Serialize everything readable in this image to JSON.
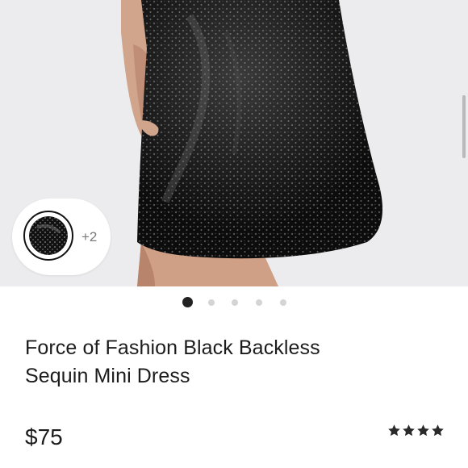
{
  "product": {
    "title_line1": "Force of Fashion Black Backless",
    "title_line2": "Sequin Mini Dress",
    "price": "$75",
    "rating": 4,
    "rating_max": 4
  },
  "gallery": {
    "image_count": 5,
    "active_index": 0,
    "more_colors_label": "+2"
  },
  "colors": {
    "background": "#ececee",
    "dot_active": "#222222",
    "dot_inactive": "#d4d4d4",
    "star": "#2a2a2a",
    "text": "#1c1c1c"
  },
  "icons": {
    "star": "star-icon",
    "swatch": "color-swatch"
  }
}
